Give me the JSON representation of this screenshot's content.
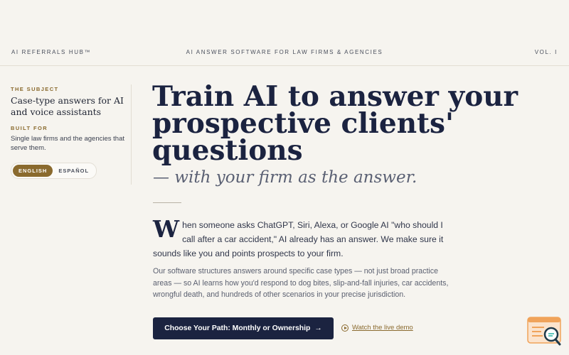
{
  "topbar": {
    "brand": "AI REFERRALS HUB™",
    "tagline": "AI ANSWER SOFTWARE FOR LAW FIRMS & AGENCIES",
    "volume": "VOL. I"
  },
  "sidebar": {
    "subject_label": "THE SUBJECT",
    "subject": "Case-type answers for AI and voice assistants",
    "built_label": "BUILT FOR",
    "built_for": "Single law firms and the agencies that serve them.",
    "languages": [
      "ENGLISH",
      "ESPAÑOL"
    ],
    "active_language": "ENGLISH"
  },
  "hero": {
    "headline": "Train AI to answer your prospective clients' questions",
    "subheadline": "— with your firm as the answer.",
    "lead_dropcap": "W",
    "lead_rest": "hen someone asks ChatGPT, Siri, Alexa, or Google AI \"who should I call after a car accident,\" AI already has an answer. We make sure it sounds like you and points prospects to your firm.",
    "body": "Our software structures answers around specific case types — not just broad practice areas — so AI learns how you'd respond to dog bites, slip-and-fall injuries, car accidents, wrongful death, and hundreds of other scenarios in your precise jurisdiction.",
    "cta_label": "Choose Your Path: Monthly or Ownership",
    "cta_arrow": "→",
    "demo_label": "Watch the live demo"
  },
  "colors": {
    "background": "#f6f4ef",
    "navy": "#1b2340",
    "gold": "#8a6a2e",
    "widget": "#f0a35a"
  },
  "icons": {
    "demo": "play-circle-icon",
    "widget": "search-chat-widget-icon"
  }
}
